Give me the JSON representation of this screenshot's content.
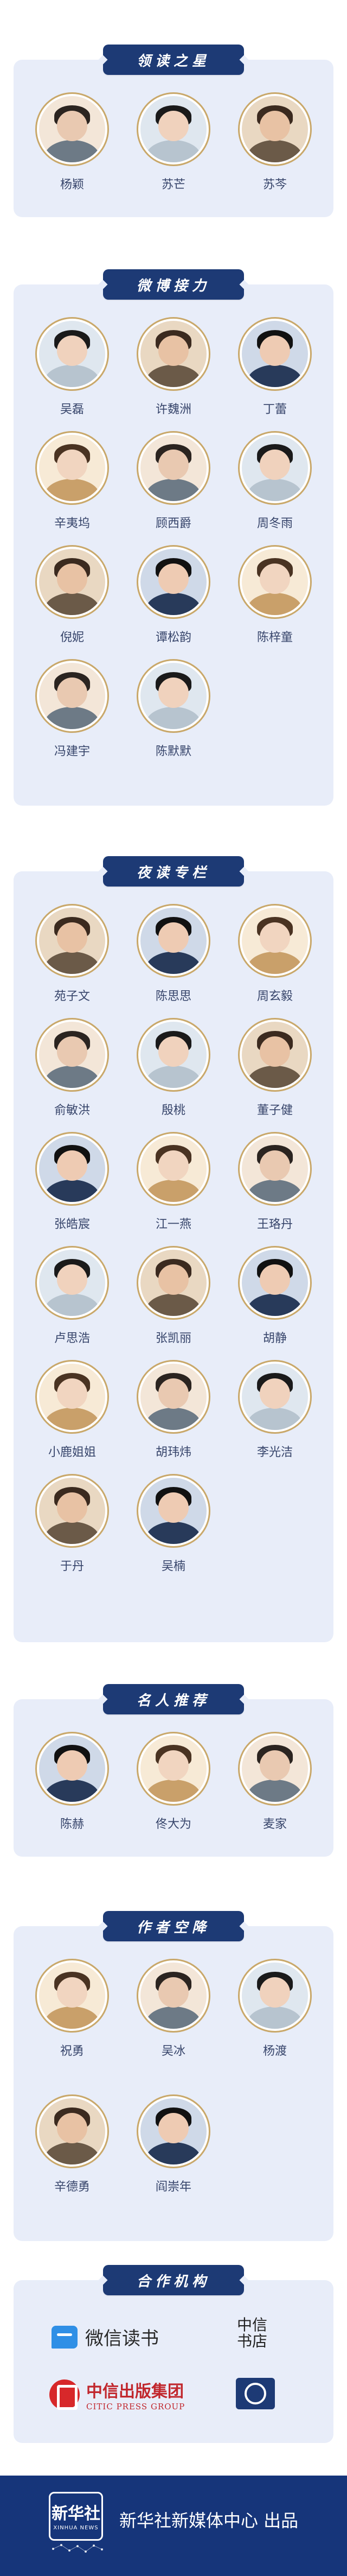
{
  "sections": [
    {
      "title": "领读之星",
      "people": [
        "杨颖",
        "苏芒",
        "苏芩"
      ]
    },
    {
      "title": "微博接力",
      "people": [
        "吴磊",
        "许魏洲",
        "丁蕾",
        "辛夷坞",
        "顾西爵",
        "周冬雨",
        "倪妮",
        "谭松韵",
        "陈梓童",
        "冯建宇",
        "陈默默"
      ]
    },
    {
      "title": "夜读专栏",
      "people": [
        "苑子文",
        "陈思思",
        "周玄毅",
        "俞敏洪",
        "殷桃",
        "董子健",
        "张皓宸",
        "江一燕",
        "王珞丹",
        "卢思浩",
        "张凯丽",
        "胡静",
        "小鹿姐姐",
        "胡玮炜",
        "李光洁",
        "于丹",
        "吴楠"
      ]
    },
    {
      "title": "名人推荐",
      "people": [
        "陈赫",
        "佟大为",
        "麦家"
      ]
    },
    {
      "title": "作者空降",
      "people": [
        "祝勇",
        "吴冰",
        "杨渡",
        "辛德勇",
        "阎崇年"
      ]
    },
    {
      "title": "合作机构",
      "partners": {
        "wechat_read": "微信读书",
        "zhongxin_store": "中信书店",
        "citic_cn": "中信出版集团",
        "citic_en": "CITIC PRESS GROUP"
      }
    }
  ],
  "footer": {
    "logo_cn": "新华社",
    "logo_en": "XINHUA NEWS",
    "text": "新华社新媒体中心 出品"
  }
}
